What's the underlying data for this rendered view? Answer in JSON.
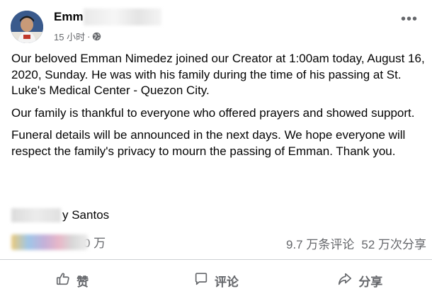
{
  "post": {
    "author_name": "Emm",
    "time": "15 小时",
    "meta_separator": "·",
    "more_label": "•••",
    "paragraphs": [
      "Our beloved Emman Nimedez joined our Creator at 1:00am today, August 16, 2020, Sunday. He was with his family during the time of his passing at St. Luke's Medical Center - Quezon City.",
      "Our family is thankful to everyone who offered prayers and showed support.",
      "Funeral details will be announced in the next days. We hope everyone will respect the family's privacy to mourn the passing of Emman. Thank you."
    ],
    "signature": "y Santos"
  },
  "stats": {
    "reactions_count": "0 万",
    "comments": "9.7 万条评论",
    "shares": "52 万次分享"
  },
  "actions": {
    "like": "赞",
    "comment": "评论",
    "share": "分享"
  },
  "icons": {
    "like": "thumbs-up-icon",
    "comment": "comment-bubble-icon",
    "share": "share-arrow-icon",
    "globe": "globe-icon",
    "more": "more-dots-icon"
  },
  "colors": {
    "text": "#050505",
    "secondary": "#65676b",
    "divider": "#ced0d4",
    "background": "#ffffff"
  }
}
